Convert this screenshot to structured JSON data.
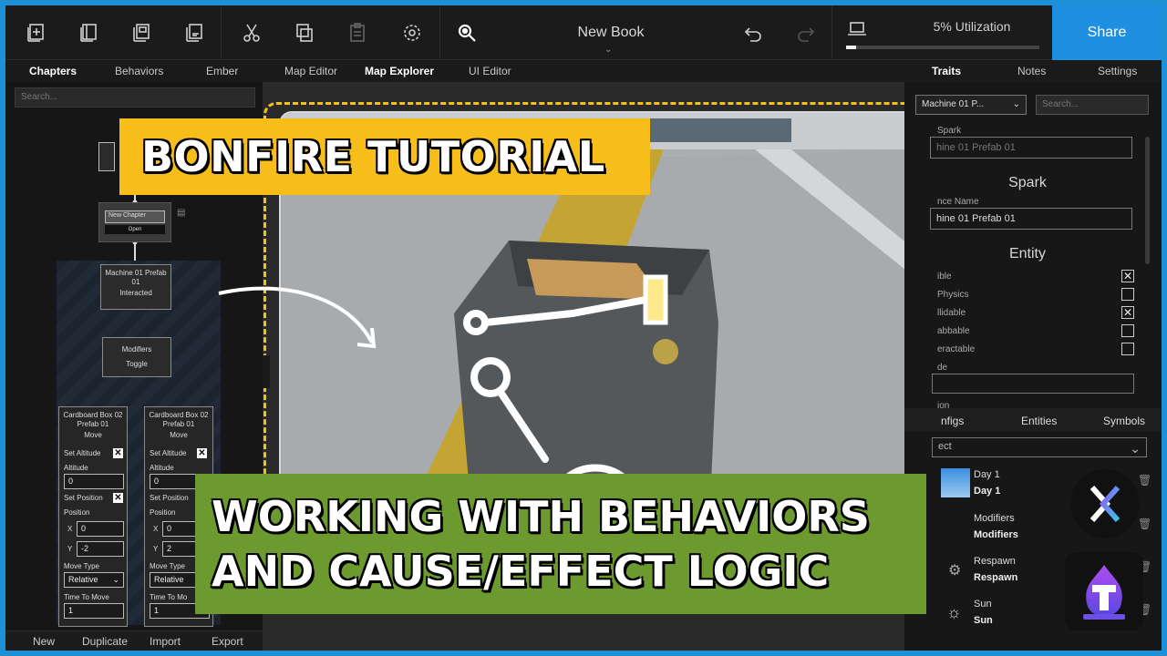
{
  "toolbar": {
    "book_title": "New Book",
    "utilization_label": "5% Utilization",
    "utilization_fraction": 0.05,
    "share_label": "Share",
    "icons": [
      "new-chapter-icon",
      "book-icon",
      "copy-icon",
      "paste-icon",
      "cut-icon",
      "duplicate-icon",
      "clipboard-icon",
      "gear-icon",
      "zoom-icon",
      "undo-icon",
      "redo-icon",
      "laptop-icon"
    ]
  },
  "left_tabs": [
    "Chapters",
    "Behaviors",
    "Ember"
  ],
  "center_tabs": [
    "Map Editor",
    "Map Explorer",
    "UI Editor"
  ],
  "right_tabs": [
    "Traits",
    "Notes",
    "Settings"
  ],
  "left_panel": {
    "search_placeholder": "Search...",
    "chapter_node": {
      "title": "New Chapter",
      "button": "Open"
    },
    "trigger_node": {
      "title": "Machine 01 Prefab 01",
      "event": "Interacted"
    },
    "modifier_node": {
      "title": "Modifiers",
      "action": "Toggle"
    },
    "move_nodes": [
      {
        "title": "Cardboard Box 02 Prefab 01",
        "action": "Move",
        "set_altitude_label": "Set Altitude",
        "altitude_label": "Altitude",
        "altitude_value": "0",
        "set_position_label": "Set Position",
        "position_label": "Position",
        "x_label": "X",
        "x_value": "0",
        "y_label": "Y",
        "y_value": "-2",
        "move_type_label": "Move Type",
        "move_type_value": "Relative",
        "time_label": "Time To Move",
        "time_value": "1"
      },
      {
        "title": "Cardboard Box 02 Prefab 01",
        "action": "Move",
        "set_altitude_label": "Set Altitude",
        "altitude_label": "Altitude",
        "altitude_value": "0",
        "set_position_label": "Set Position",
        "position_label": "Position",
        "x_label": "X",
        "x_value": "0",
        "y_label": "Y",
        "y_value": "2",
        "move_type_label": "Move Type",
        "move_type_value": "Relative",
        "time_label": "Time To Mo",
        "time_value": "1"
      }
    ],
    "bottom_actions": [
      "New",
      "Duplicate",
      "Import",
      "Export"
    ]
  },
  "right_panel": {
    "select_value": "Machine 01 P...",
    "search_placeholder": "Search...",
    "spark_small_label": "Spark",
    "spark_field_value": "hine 01 Prefab 01",
    "spark_heading": "Spark",
    "instance_name_label": "nce Name",
    "instance_name_value": "hine 01 Prefab 01",
    "entity_heading": "Entity",
    "entity_flags": [
      {
        "label": "ible",
        "checked": true
      },
      {
        "label": "Physics",
        "checked": false
      },
      {
        "label": "llidable",
        "checked": true
      },
      {
        "label": "abbable",
        "checked": false
      },
      {
        "label": "eractable",
        "checked": false
      },
      {
        "label": "de",
        "checked": null
      }
    ],
    "lower_label": "ion",
    "lower_tabs": [
      "nfigs",
      "Entities",
      "Symbols"
    ],
    "dropdown_value": "ect",
    "items": [
      {
        "name": "Day 1",
        "sub": "Day 1"
      },
      {
        "name": "Modifiers",
        "sub": "Modifiers"
      },
      {
        "name": "Respawn",
        "sub": "Respawn"
      },
      {
        "name": "Sun",
        "sub": "Sun"
      }
    ]
  },
  "overlay": {
    "title": "BONFIRE TUTORIAL",
    "subtitle_line1": "WORKING WITH BEHAVIORS",
    "subtitle_line2": "AND CAUSE/EFFECT LOGIC",
    "accent_yellow": "#f6bd1b",
    "accent_green": "#6c9a2e",
    "accent_blue": "#1f8fe0"
  }
}
